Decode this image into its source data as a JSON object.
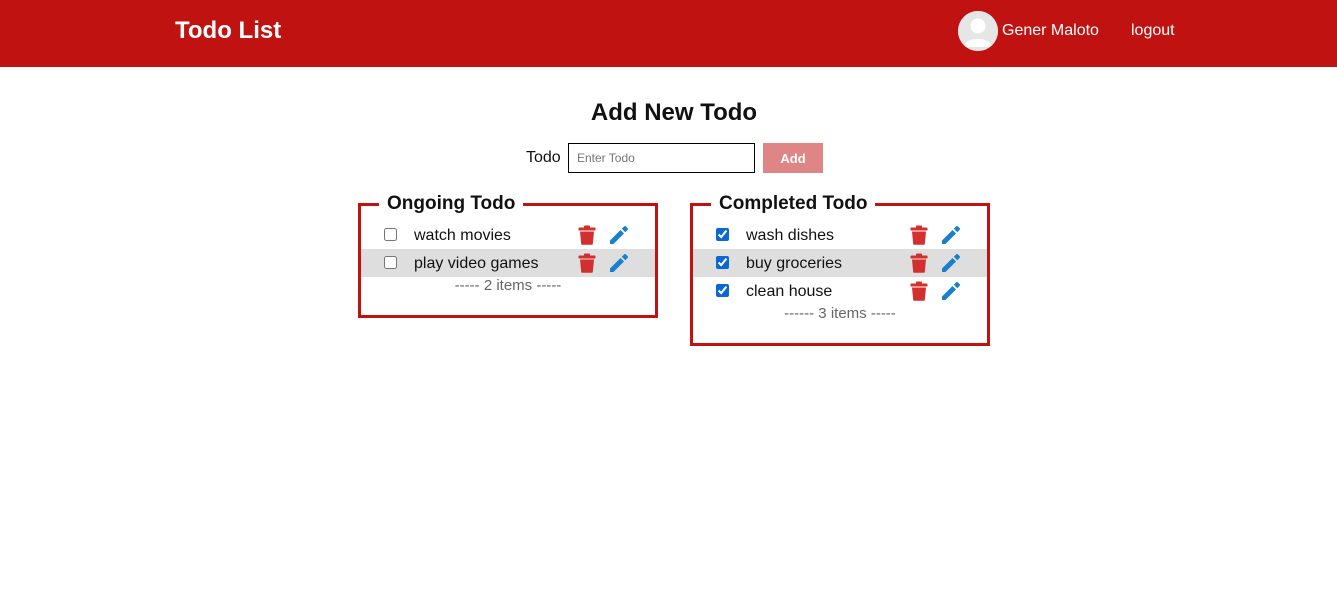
{
  "header": {
    "title": "Todo List",
    "username": "Gener Maloto",
    "logout_label": "logout",
    "bg_color": "#c11212"
  },
  "add_form": {
    "heading": "Add New Todo",
    "label": "Todo",
    "placeholder": "Enter Todo",
    "value": "",
    "button_label": "Add"
  },
  "ongoing": {
    "title": "Ongoing Todo",
    "items": [
      {
        "text": "watch movies",
        "checked": false
      },
      {
        "text": "play video games",
        "checked": false
      }
    ],
    "count_label": "----- 2 items -----"
  },
  "completed": {
    "title": "Completed Todo",
    "items": [
      {
        "text": "wash dishes",
        "checked": true
      },
      {
        "text": "buy groceries",
        "checked": true
      },
      {
        "text": "clean house",
        "checked": true
      }
    ],
    "count_label": "------ 3 items -----"
  },
  "icons": {
    "delete": "trash-icon",
    "edit": "pencil-icon",
    "delete_color": "#d32f2f",
    "edit_color": "#1a7fcc"
  }
}
